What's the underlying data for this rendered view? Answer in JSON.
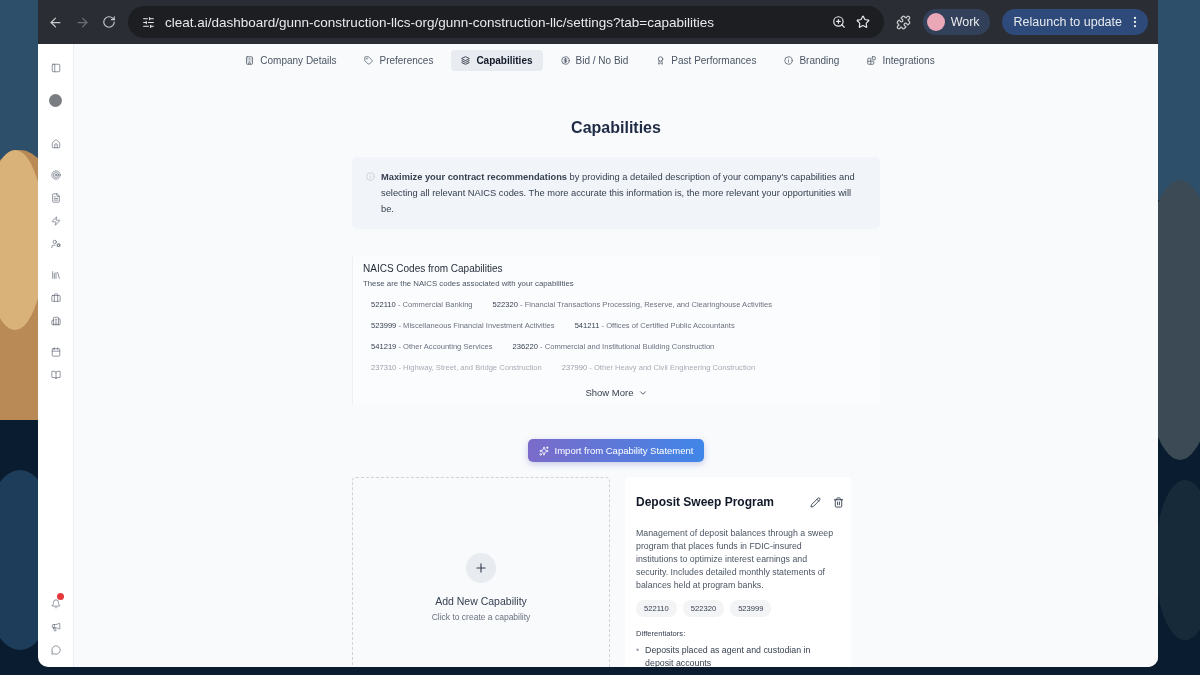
{
  "browser": {
    "url": "cleat.ai/dashboard/gunn-construction-llcs-org/gunn-construction-llc/settings?tab=capabilities",
    "profile": "Work",
    "relaunch": "Relaunch to update"
  },
  "sidebar": {
    "top": [
      {
        "kind": "panel"
      },
      {
        "kind": "avatar"
      }
    ],
    "items": [
      {
        "kind": "home"
      },
      {
        "kind": "target"
      },
      {
        "kind": "file"
      },
      {
        "kind": "zap"
      },
      {
        "kind": "users"
      },
      {
        "kind": "library"
      },
      {
        "kind": "briefcase"
      },
      {
        "kind": "building"
      },
      {
        "kind": "calendar"
      },
      {
        "kind": "book"
      }
    ],
    "bottom": [
      {
        "kind": "bell",
        "badge": true
      },
      {
        "kind": "megaphone",
        "badge": false
      },
      {
        "kind": "chat",
        "badge": false
      }
    ]
  },
  "tabs": [
    {
      "label": "Company Details",
      "kind": "company",
      "selected": false
    },
    {
      "label": "Preferences",
      "kind": "tag",
      "selected": false
    },
    {
      "label": "Capabilities",
      "kind": "layers",
      "selected": true
    },
    {
      "label": "Bid / No Bid",
      "kind": "dollar",
      "selected": false
    },
    {
      "label": "Past Performances",
      "kind": "award",
      "selected": false
    },
    {
      "label": "Branding",
      "kind": "info",
      "selected": false
    },
    {
      "label": "Integrations",
      "kind": "blocks",
      "selected": false
    }
  ],
  "title": "Capabilities",
  "notice": "**Maximize your contract recommendations** by providing a detailed description of your company's capabilities and selecting all relevant NAICS codes. The more accurate this information is, the more relevant your opportunities will be.",
  "naics": {
    "title": "NAICS Codes from Capabilities",
    "subtitle": "These are the NAICS codes associated with your capabilities",
    "rows": [
      [
        {
          "code": "522110",
          "name": "- Commercial Banking",
          "faded": false
        },
        {
          "code": "522320",
          "name": "- Financial Transactions Processing, Reserve, and Clearinghouse Activities",
          "faded": false
        }
      ],
      [
        {
          "code": "523999",
          "name": "- Miscellaneous Financial Investment Activities",
          "faded": false
        },
        {
          "code": "541211",
          "name": "- Offices of Certified Public Accountants",
          "faded": false
        }
      ],
      [
        {
          "code": "541219",
          "name": "- Other Accounting Services",
          "faded": false
        },
        {
          "code": "236220",
          "name": "- Commercial and Institutional Building Construction",
          "faded": false
        }
      ],
      [
        {
          "code": "237310",
          "name": "- Highway, Street, and Bridge Construction",
          "faded": true
        },
        {
          "code": "237990",
          "name": "- Other Heavy and Civil Engineering Construction",
          "faded": true
        }
      ]
    ],
    "show_more": "Show More"
  },
  "import_button": "Import from Capability Statement",
  "add_card": {
    "title": "Add New Capability",
    "subtitle": "Click to create a capability"
  },
  "capability": {
    "title": "Deposit Sweep Program",
    "description": "Management of deposit balances through a sweep program that places funds in FDIC-insured institutions to optimize interest earnings and security. Includes detailed monthly statements of balances held at program banks.",
    "codes": [
      "522110",
      "522320",
      "523999"
    ],
    "differentiators_label": "Differentiators:",
    "marker": "•",
    "differentiators": [
      "Deposits placed as agent and custodian in deposit accounts"
    ]
  }
}
